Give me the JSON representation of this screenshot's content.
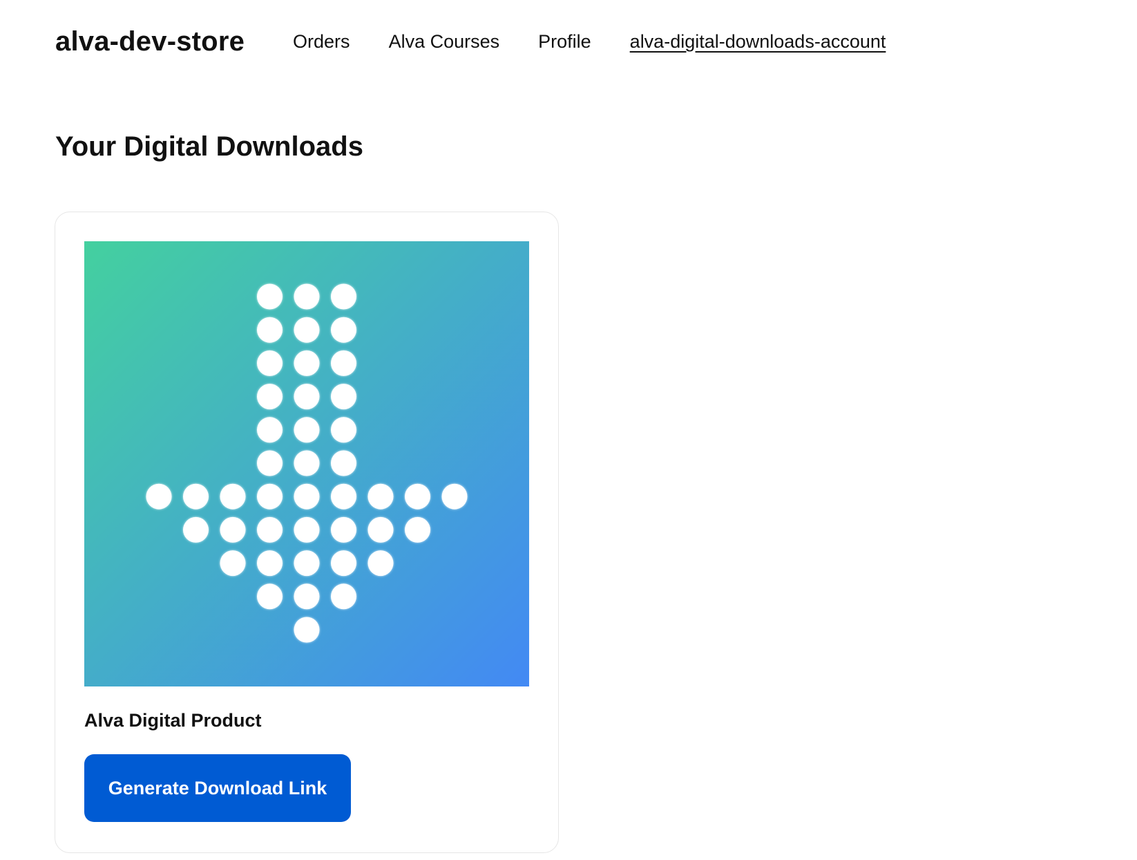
{
  "header": {
    "store_name": "alva-dev-store",
    "nav": [
      {
        "label": "Orders"
      },
      {
        "label": "Alva Courses"
      },
      {
        "label": "Profile"
      },
      {
        "label": "alva-digital-downloads-account",
        "active": true
      }
    ]
  },
  "main": {
    "title": "Your Digital Downloads",
    "products": [
      {
        "name": "Alva Digital Product",
        "button_label": "Generate Download Link",
        "image": {
          "icon": "dotted-download-arrow-icon",
          "gradient_start": "#44d09f",
          "gradient_end": "#4389f4",
          "dot_color": "#ffffff"
        }
      }
    ]
  },
  "colors": {
    "button_bg": "#005bd3",
    "button_text": "#ffffff",
    "card_border": "#e6e6e6"
  }
}
